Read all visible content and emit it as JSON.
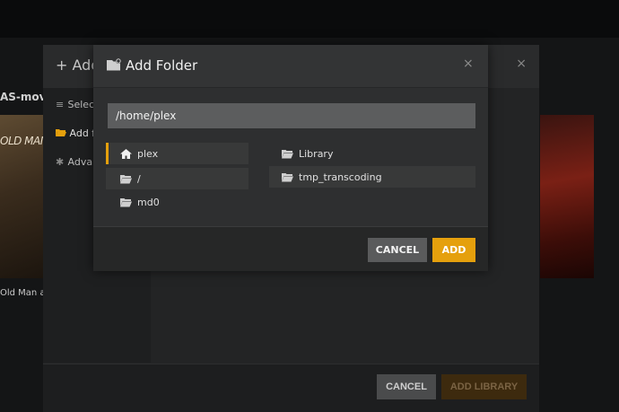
{
  "background": {
    "left_label": "AS-movie",
    "left_poster_title": "OLD MAN",
    "left_poster_caption": "Old Man a"
  },
  "library_dialog": {
    "title": "+ Add",
    "close_glyph": "×",
    "sidebar": {
      "items": [
        {
          "label": "Select"
        },
        {
          "label": "Add f"
        },
        {
          "label": "Adva"
        }
      ]
    },
    "footer": {
      "cancel_label": "CANCEL",
      "add_label": "ADD LIBRARY"
    }
  },
  "add_folder_modal": {
    "title": "Add Folder",
    "close_glyph": "×",
    "path_value": "/home/plex",
    "folders_left": [
      {
        "label": "plex",
        "icon": "home-icon",
        "selected": true
      },
      {
        "label": "/",
        "icon": "folder-open-icon",
        "selected": false
      },
      {
        "label": "md0",
        "icon": "folder-open-icon",
        "selected": false
      }
    ],
    "folders_right": [
      {
        "label": "Library",
        "icon": "folder-open-icon"
      },
      {
        "label": "tmp_transcoding",
        "icon": "folder-open-icon"
      }
    ],
    "footer": {
      "cancel_label": "CANCEL",
      "add_label": "ADD"
    }
  },
  "colors": {
    "accent": "#e5a00d",
    "modal_bg": "#2e2f30",
    "input_bg": "#5c5d5e"
  }
}
